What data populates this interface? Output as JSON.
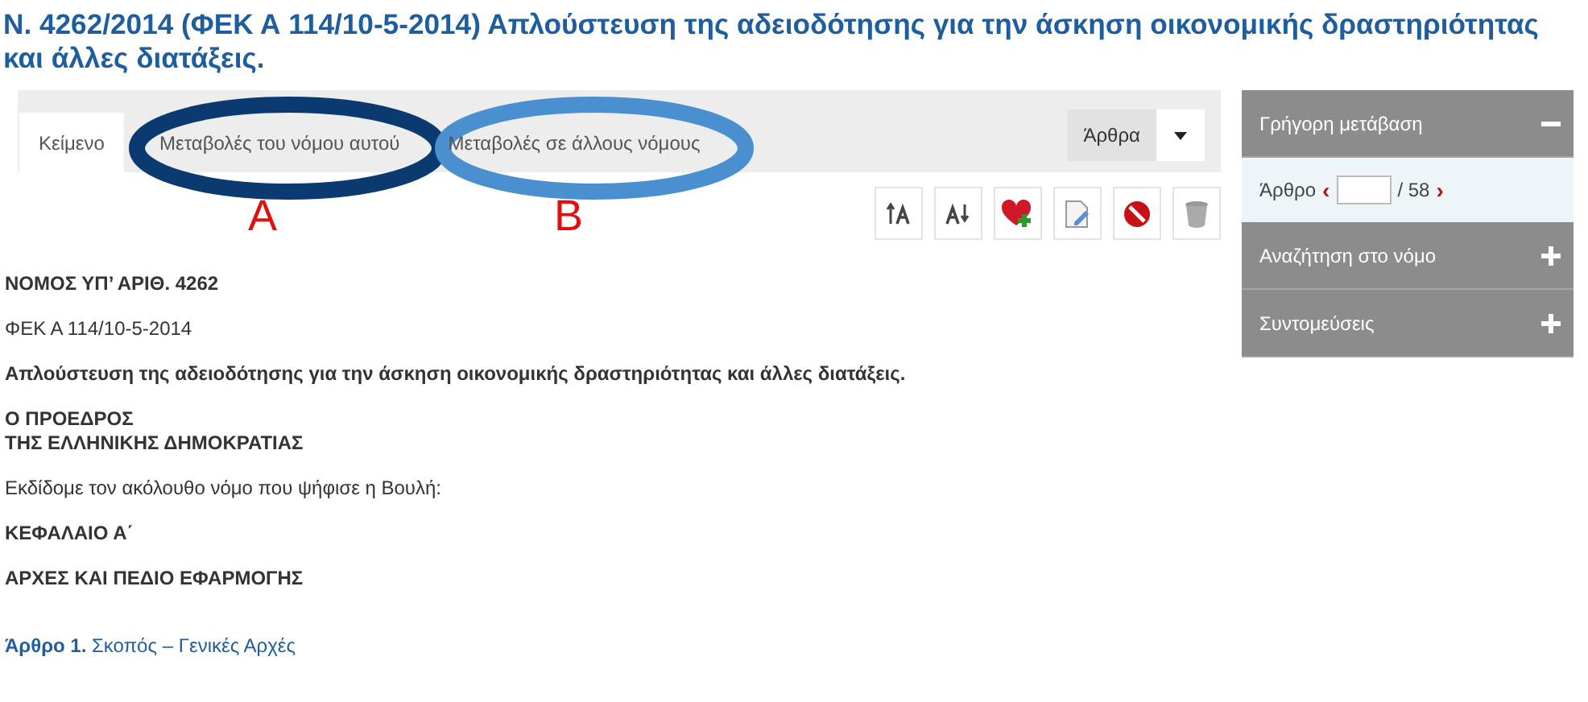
{
  "title": "Ν. 4262/2014 (ΦΕΚ Α 114/10-5-2014) Απλούστευση της αδειοδότησης για την άσκηση οικονομικής δραστηριότητας και άλλες διατάξεις.",
  "tabs": [
    {
      "label": "Κείμενο",
      "selected": true
    },
    {
      "label": "Μεταβολές του νόμου αυτού",
      "selected": false
    },
    {
      "label": "Μεταβολές σε άλλους νόμους",
      "selected": false
    }
  ],
  "articles_dropdown": {
    "label": "Άρθρα"
  },
  "annotations": [
    {
      "label": "A",
      "color": "#0b3a70"
    },
    {
      "label": "B",
      "color": "#4a8fd0"
    }
  ],
  "content": [
    {
      "kind": "bold",
      "lines": [
        "ΝΟΜΟΣ ΥΠ’ ΑΡΙΘ. 4262"
      ]
    },
    {
      "kind": "normal",
      "lines": [
        "ΦΕΚ Α 114/10-5-2014"
      ]
    },
    {
      "kind": "bold",
      "lines": [
        "Απλούστευση της αδειοδότησης για την άσκηση οικονομικής δραστηριότητας και άλλες διατάξεις."
      ]
    },
    {
      "kind": "bold",
      "lines": [
        "Ο ΠΡΟΕΔΡΟΣ",
        "ΤΗΣ ΕΛΛΗΝΙΚΗΣ ΔΗΜΟΚΡΑΤΙΑΣ"
      ]
    },
    {
      "kind": "normal",
      "lines": [
        "Εκδίδομε τον ακόλουθο νόμο που ψήφισε η Βουλή:"
      ]
    },
    {
      "kind": "bold",
      "lines": [
        "ΚΕΦΑΛΑΙΟ Α΄"
      ]
    },
    {
      "kind": "bold",
      "lines": [
        "ΑΡΧΕΣ ΚΑΙ ΠΕΔΙΟ ΕΦΑΡΜΟΓΗΣ"
      ]
    },
    {
      "kind": "link",
      "lines": [
        "**Άρθρο 1.** Σκοπός – Γενικές Αρχές"
      ]
    }
  ],
  "sidebar": [
    {
      "title": "Γρήγορη μετάβαση",
      "expanded": true,
      "article_label": "Άρθρο",
      "prev": "‹",
      "total": "/ 58",
      "next": "›"
    },
    {
      "title": "Αναζήτηση στο νόμο",
      "expanded": false
    },
    {
      "title": "Συντομεύσεις",
      "expanded": false
    }
  ]
}
